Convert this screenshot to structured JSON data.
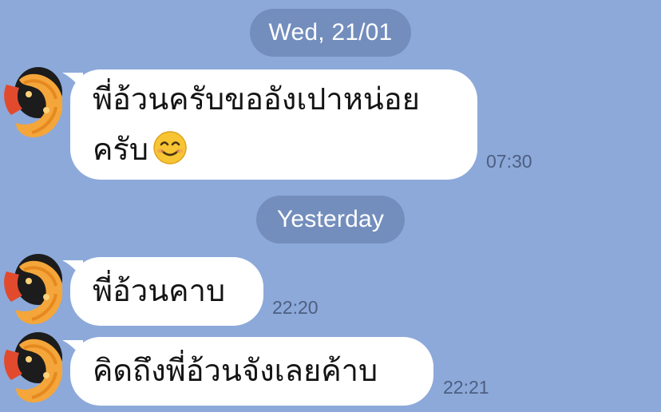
{
  "separators": {
    "first": "Wed, 21/01",
    "second": "Yesterday"
  },
  "messages": [
    {
      "line1": "พี่อ้วนครับขออังเปาหน่อย",
      "line2": "ครับ",
      "emoji": "smiling-face-emoji",
      "time": "07:30"
    },
    {
      "text": "พี่อ้วนคาบ",
      "time": "22:20"
    },
    {
      "text": "คิดถึงพี่อ้วนจังเลยค้าบ",
      "time": "22:21"
    }
  ],
  "avatar": {
    "icon": "fried-shrimp-avatar-icon"
  },
  "colors": {
    "background": "#8ca9da",
    "bubble": "#ffffff",
    "date_chip": "#6a86b5",
    "timestamp": "#4d5f80",
    "text": "#141414"
  }
}
